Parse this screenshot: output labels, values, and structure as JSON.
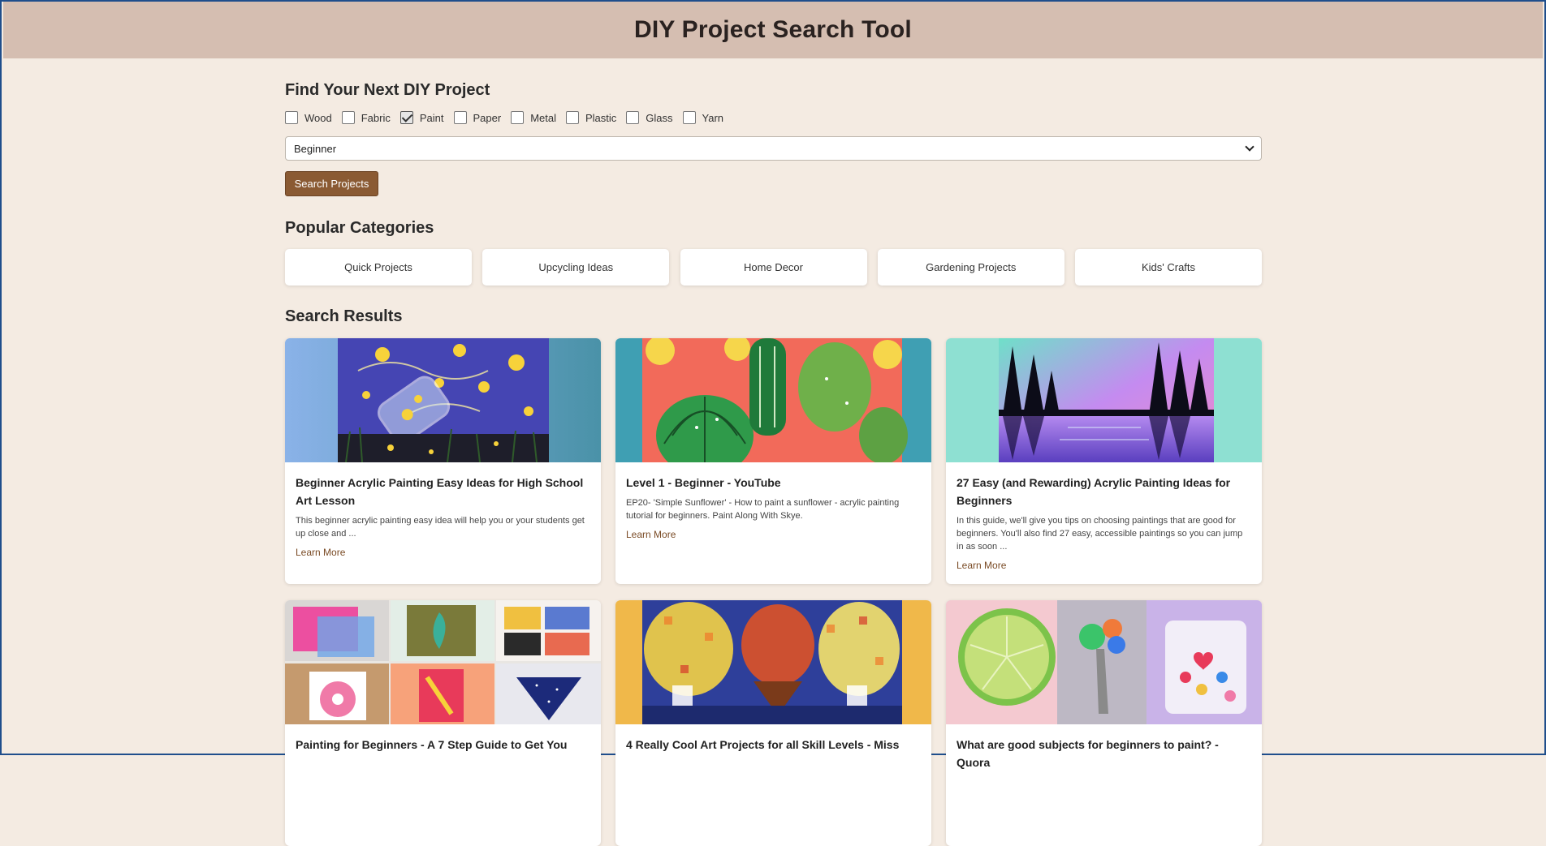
{
  "header": {
    "title": "DIY Project Search Tool"
  },
  "search": {
    "title": "Find Your Next DIY Project",
    "materials": [
      {
        "label": "Wood",
        "checked": false
      },
      {
        "label": "Fabric",
        "checked": false
      },
      {
        "label": "Paint",
        "checked": true
      },
      {
        "label": "Paper",
        "checked": false
      },
      {
        "label": "Metal",
        "checked": false
      },
      {
        "label": "Plastic",
        "checked": false
      },
      {
        "label": "Glass",
        "checked": false
      },
      {
        "label": "Yarn",
        "checked": false
      }
    ],
    "difficulty_selected": "Beginner",
    "button_label": "Search Projects"
  },
  "popular": {
    "title": "Popular Categories",
    "categories": [
      "Quick Projects",
      "Upcycling Ideas",
      "Home Decor",
      "Gardening Projects",
      "Kids' Crafts"
    ]
  },
  "results": {
    "title": "Search Results",
    "link_label": "Learn More",
    "cards": [
      {
        "title": "Beginner Acrylic Painting Easy Ideas for High School Art Lesson",
        "desc": "This beginner acrylic painting easy idea will help you or your students get up close and ...",
        "image": "starry-jar-painting"
      },
      {
        "title": "Level 1 - Beginner - YouTube",
        "desc": "EP20- 'Simple Sunflower' - How to paint a sunflower - acrylic painting tutorial for beginners. Paint Along With Skye.",
        "image": "cactus-painting"
      },
      {
        "title": "27 Easy (and Rewarding) Acrylic Painting Ideas for Beginners",
        "desc": "In this guide, we'll give you tips on choosing paintings that are good for beginners. You'll also find 27 easy, accessible paintings so you can jump in as soon ...",
        "image": "aurora-forest-painting"
      },
      {
        "title": "Painting for Beginners - A 7 Step Guide to Get You",
        "desc": "",
        "image": "painting-collage"
      },
      {
        "title": "4 Really Cool Art Projects for all Skill Levels - Miss",
        "desc": "",
        "image": "hot-air-balloon-painting"
      },
      {
        "title": "What are good subjects for beginners to paint? - Quora",
        "desc": "",
        "image": "lime-and-palette-photos"
      }
    ]
  },
  "colors": {
    "header_bg": "#d5beb1",
    "page_bg": "#f4ebe2",
    "button_bg": "#8a5a33",
    "link": "#7a4b25"
  }
}
